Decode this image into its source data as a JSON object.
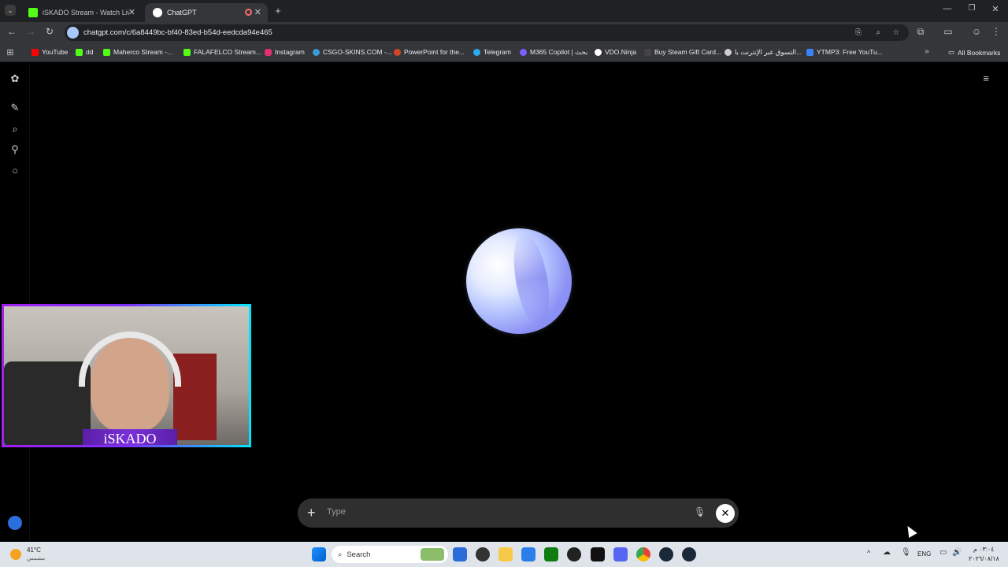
{
  "tabs": [
    {
      "title": "iSKADO Stream - Watch Live on",
      "favicon": "kick-icon",
      "color": "#53fc18"
    },
    {
      "title": "ChatGPT",
      "favicon": "chatgpt-icon",
      "color": "#ffffff"
    }
  ],
  "url": "chatgpt.com/c/6a8449bc-bf40-83ed-b54d-eedcda94e465",
  "bookmarks": [
    {
      "label": "YouTube",
      "color": "#ff0000"
    },
    {
      "label": "dd",
      "color": "#53fc18"
    },
    {
      "label": "Maherco Stream -...",
      "color": "#53fc18"
    },
    {
      "label": "FALAFELCO Stream...",
      "color": "#53fc18"
    },
    {
      "label": "Instagram",
      "color": "#e1306c"
    },
    {
      "label": "CSGO-SKINS.COM -...",
      "color": "#3a9bd9"
    },
    {
      "label": "PowerPoint for the...",
      "color": "#d24726"
    },
    {
      "label": "Telegram",
      "color": "#2aabee"
    },
    {
      "label": "M365 Copilot | بحث",
      "color": "#7b61ff"
    },
    {
      "label": "VDO.Ninja",
      "color": "#ffffff"
    },
    {
      "label": "Buy Steam Gift Card...",
      "color": "#cccccc"
    },
    {
      "label": "التسوق عبر الإنترنت با...",
      "color": "#cccccc"
    },
    {
      "label": "YTMP3: Free YouTu...",
      "color": "#3b82f6"
    }
  ],
  "all_bookmarks": "All Bookmarks",
  "chat": {
    "input_placeholder": "Type",
    "webcam_name": "iSKADO"
  },
  "taskbar": {
    "weather_temp": "41°C",
    "weather_desc": "مشمس",
    "search_label": "Search",
    "language": "ENG",
    "time": "٠٣:٠٤ م",
    "date": "٢٠٢٦/٠٨/١٨"
  },
  "icons": {
    "sidebar": [
      "chatgpt-logo-icon",
      "new-chat-icon",
      "search-icon",
      "pin-icon",
      "chat-bubble-icon"
    ],
    "settings": "sliders-icon"
  }
}
